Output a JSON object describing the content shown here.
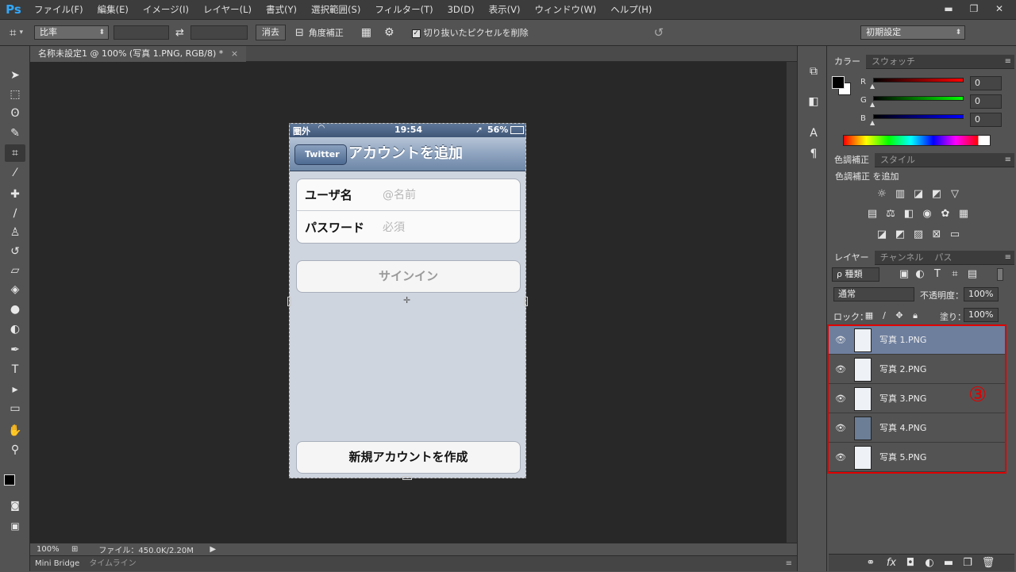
{
  "app": {
    "logo": "Ps"
  },
  "menu": [
    "ファイル(F)",
    "編集(E)",
    "イメージ(I)",
    "レイヤー(L)",
    "書式(Y)",
    "選択範囲(S)",
    "フィルター(T)",
    "3D(D)",
    "表示(V)",
    "ウィンドウ(W)",
    "ヘルプ(H)"
  ],
  "window_controls": [
    "▬",
    "❐",
    "✕"
  ],
  "options": {
    "ratio_label": "比率",
    "swap_icon": "⇄",
    "clear_label": "消去",
    "straighten_label": "角度補正",
    "delete_cropped_label": "切り抜いたピクセルを削除",
    "delete_cropped_checked": true,
    "reset_icon": "↺",
    "workspace_label": "初期設定"
  },
  "document": {
    "tab_title": "名称未設定1 @ 100% (写真 1.PNG, RGB/8) *",
    "zoom": "100%",
    "file_info": "ファイル：450.0K/2.20M"
  },
  "bottom_tabs": [
    "Mini Bridge",
    "タイムライン"
  ],
  "phone": {
    "carrier": "圏外",
    "time": "19:54",
    "battery": "56%",
    "back_label": "Twitter",
    "title": "アカウントを追加",
    "username_label": "ユーザ名",
    "username_placeholder": "@名前",
    "password_label": "パスワード",
    "password_placeholder": "必須",
    "signin_label": "サインイン",
    "create_label": "新規アカウントを作成"
  },
  "color_panel": {
    "tabs": [
      "カラー",
      "スウォッチ"
    ],
    "r_label": "R",
    "r_value": "0",
    "g_label": "G",
    "g_value": "0",
    "b_label": "B",
    "b_value": "0"
  },
  "adjust_panel": {
    "tabs": [
      "色調補正",
      "スタイル"
    ],
    "add_label": "色調補正 を追加"
  },
  "layers_panel": {
    "tabs": [
      "レイヤー",
      "チャンネル",
      "パス"
    ],
    "filter_label": "ρ 種類",
    "blend_mode": "通常",
    "opacity_label": "不透明度：",
    "opacity_value": "100%",
    "lock_label": "ロック：",
    "fill_label": "塗り：",
    "fill_value": "100%",
    "layers": [
      "写真 1.PNG",
      "写真 2.PNG",
      "写真 3.PNG",
      "写真 4.PNG",
      "写真 5.PNG"
    ],
    "selected_index": 0,
    "annotation": "③"
  },
  "colors": {
    "selection_highlight": "#6e7f9e",
    "annotation_red": "#e00000"
  }
}
